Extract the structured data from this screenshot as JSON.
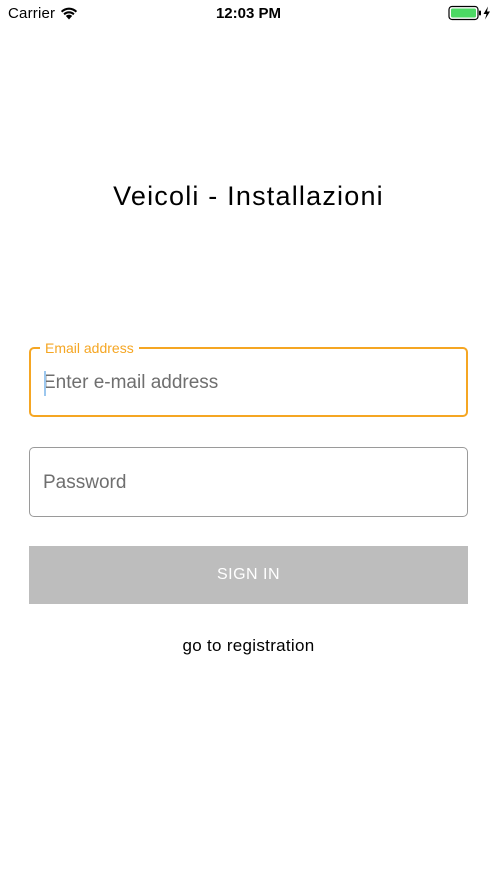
{
  "status_bar": {
    "carrier": "Carrier",
    "time": "12:03 PM",
    "wifi_icon": "wifi-icon",
    "battery_icon": "battery-charging-icon",
    "battery_color": "#4cd964"
  },
  "app": {
    "title": "Veicoli - Installazioni"
  },
  "form": {
    "email": {
      "label": "Email address",
      "placeholder": "Enter e-mail address",
      "value": "",
      "focus_color": "#f5a623"
    },
    "password": {
      "placeholder": "Password",
      "value": ""
    },
    "signin_label": "SIGN IN",
    "registration_label": "go to registration"
  }
}
